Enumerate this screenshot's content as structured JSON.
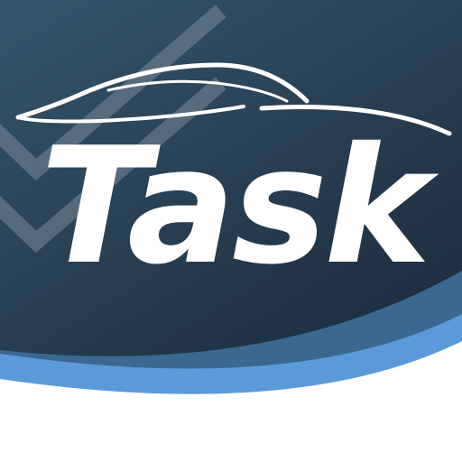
{
  "app": {
    "name": "Task"
  },
  "icons": {
    "background": "checkmark-icon",
    "emblem": "car-silhouette-icon"
  },
  "colors": {
    "background_top": "#2f4b60",
    "background_bottom": "#1d2d3e",
    "wave_light": "#5a9ad8",
    "wave_mid": "#3a6891",
    "checkmark": "#8a9aa6",
    "text": "#ffffff",
    "base": "#ffffff"
  }
}
